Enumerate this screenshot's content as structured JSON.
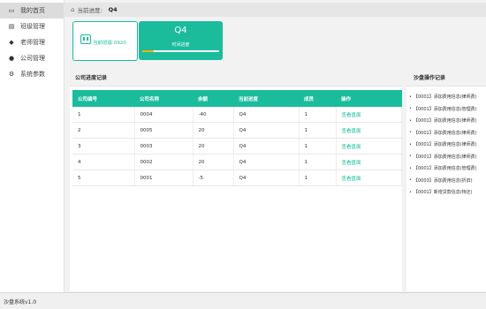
{
  "sidebar": {
    "items": [
      {
        "label": "我的首页",
        "icon": "monitor-icon"
      },
      {
        "label": "班级管理",
        "icon": "list-icon"
      },
      {
        "label": "老师管理",
        "icon": "graduation-cap-icon"
      },
      {
        "label": "公司管理",
        "icon": "users-icon"
      },
      {
        "label": "系统参数",
        "icon": "gear-icon"
      }
    ]
  },
  "breadcrumb": {
    "label": "当前进度:",
    "current": "Q4"
  },
  "cards": {
    "class_info": "当前班级:0920",
    "quarter": "Q4",
    "caption": "时间进度",
    "progress": 0.15
  },
  "records": {
    "title": "公司进度记录",
    "headers": [
      "公司编号",
      "公司名称",
      "余额",
      "当前进度",
      "成员",
      "操作"
    ],
    "rows": [
      [
        "1",
        "0004",
        "-40",
        "Q4",
        "1",
        "查看盘面"
      ],
      [
        "2",
        "0005",
        "20",
        "Q4",
        "1",
        "查看盘面"
      ],
      [
        "3",
        "0003",
        "20",
        "Q4",
        "1",
        "查看盘面"
      ],
      [
        "4",
        "0002",
        "20",
        "Q4",
        "1",
        "查看盘面"
      ],
      [
        "5",
        "0001",
        "-5",
        "Q4",
        "1",
        "查看盘面"
      ]
    ]
  },
  "log": {
    "title": "沙盘操作记录",
    "items": [
      "【0001】添加费用信息(律师费)",
      "【0001】添加费用信息(管理费)",
      "【0001】添加费用信息(律师费)",
      "【0001】添加费用信息(律师费)",
      "【0001】添加费用信息(律师费)",
      "【0001】添加费用信息(律师费)",
      "【0001】添加费用信息(管理费)",
      "【0003】添加费用信息(折旧)",
      "【0001】新增贷款信息(特还)"
    ]
  },
  "footer": {
    "text": "沙盘系统v1.0"
  },
  "colors": {
    "accent": "#1abc9c",
    "progress": "#f0b400"
  }
}
